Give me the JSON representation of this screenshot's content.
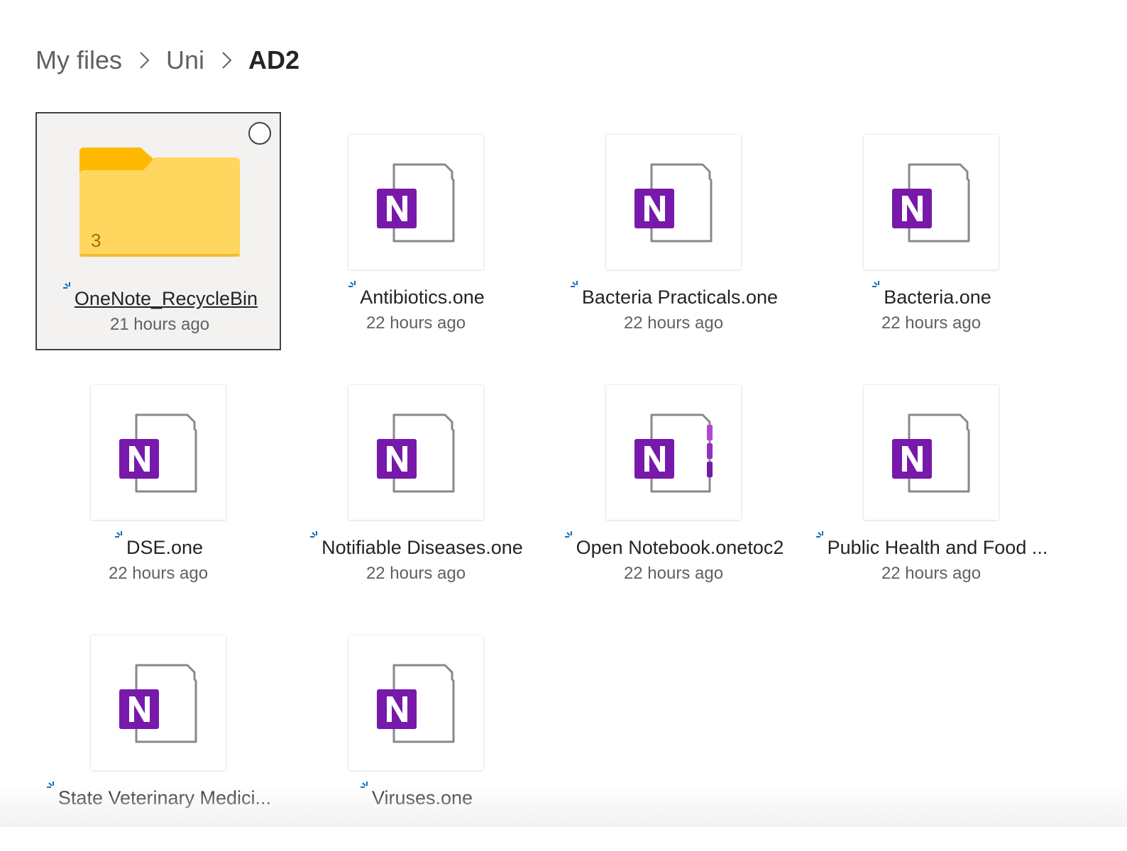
{
  "breadcrumb": [
    {
      "label": "My files"
    },
    {
      "label": "Uni"
    },
    {
      "label": "AD2"
    }
  ],
  "colors": {
    "onenote": "#7719aa",
    "folder": "#ffc83d"
  },
  "items": [
    {
      "type": "folder",
      "name": "OneNote_RecycleBin",
      "modified": "21 hours ago",
      "count": "3",
      "selected": true,
      "icon": "folder-icon"
    },
    {
      "type": "onenote",
      "name": "Antibiotics.one",
      "modified": "22 hours ago",
      "icon": "onenote-file-icon"
    },
    {
      "type": "onenote",
      "name": "Bacteria Practicals.one",
      "modified": "22 hours ago",
      "icon": "onenote-file-icon"
    },
    {
      "type": "onenote",
      "name": "Bacteria.one",
      "modified": "22 hours ago",
      "icon": "onenote-file-icon"
    },
    {
      "type": "onenote",
      "name": "DSE.one",
      "modified": "22 hours ago",
      "icon": "onenote-file-icon"
    },
    {
      "type": "onenote",
      "name": "Notifiable Diseases.one",
      "modified": "22 hours ago",
      "icon": "onenote-file-icon"
    },
    {
      "type": "onenote-toc",
      "name": "Open Notebook.onetoc2",
      "modified": "22 hours ago",
      "icon": "onenote-notebook-icon"
    },
    {
      "type": "onenote",
      "name": "Public Health and Food ...",
      "modified": "22 hours ago",
      "icon": "onenote-file-icon"
    },
    {
      "type": "onenote",
      "name": "State Veterinary Medici...",
      "modified": "",
      "icon": "onenote-file-icon"
    },
    {
      "type": "onenote",
      "name": "Viruses.one",
      "modified": "",
      "icon": "onenote-file-icon"
    }
  ]
}
